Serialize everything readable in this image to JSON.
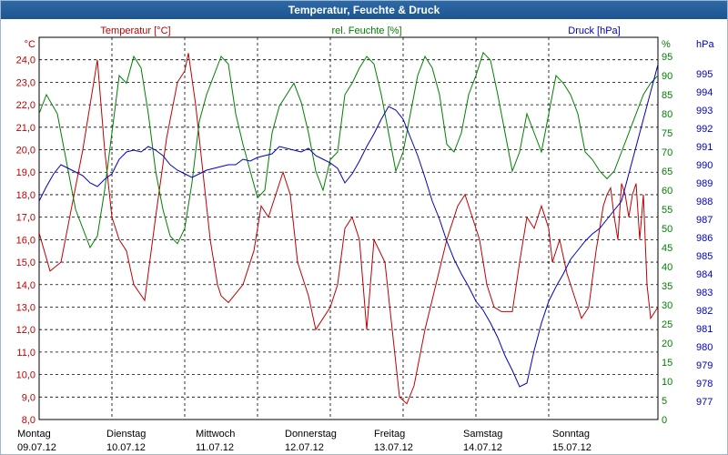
{
  "window": {
    "title": "Temperatur, Feuchte & Druck"
  },
  "chart_data": {
    "type": "line",
    "title": "Temperatur, Feuchte & Druck",
    "grid": true,
    "axes": {
      "temperature": {
        "label": "Temperatur [°C]",
        "unit": "°C",
        "color": "#c00000",
        "range": [
          8.0,
          25.0
        ],
        "ticks": [
          "8,0",
          "9,0",
          "10,0",
          "11,0",
          "12,0",
          "13,0",
          "14,0",
          "15,0",
          "16,0",
          "17,0",
          "18,0",
          "19,0",
          "20,0",
          "21,0",
          "22,0",
          "23,0",
          "24,0"
        ]
      },
      "humidity": {
        "label": "rel. Feuchte [%]",
        "unit": "%",
        "color": "#008000",
        "range": [
          0,
          100
        ],
        "ticks": [
          "0",
          "5",
          "10",
          "15",
          "20",
          "25",
          "30",
          "35",
          "40",
          "45",
          "50",
          "55",
          "60",
          "65",
          "70",
          "75",
          "80",
          "85",
          "90",
          "95"
        ]
      },
      "pressure": {
        "label": "Druck [hPa]",
        "unit": "hPa",
        "color": "#0000c0",
        "range": [
          976,
          997
        ],
        "ticks": [
          "977",
          "978",
          "979",
          "980",
          "981",
          "982",
          "983",
          "984",
          "985",
          "986",
          "987",
          "988",
          "989",
          "990",
          "991",
          "992",
          "993",
          "994",
          "995"
        ]
      }
    },
    "x_days": [
      {
        "day": "Montag",
        "date": "09.07.12"
      },
      {
        "day": "Dienstag",
        "date": "10.07.12"
      },
      {
        "day": "Mittwoch",
        "date": "11.07.12"
      },
      {
        "day": "Donnerstag",
        "date": "12.07.12"
      },
      {
        "day": "Freitag",
        "date": "13.07.12"
      },
      {
        "day": "Samstag",
        "date": "14.07.12"
      },
      {
        "day": "Sonntag",
        "date": "15.07.12"
      }
    ],
    "x_range_days": [
      0,
      7
    ],
    "series": [
      {
        "name": "Temperatur [°C]",
        "axis": "temperature",
        "color": "#c00000",
        "points": [
          [
            0.0,
            16.3
          ],
          [
            0.15,
            14.6
          ],
          [
            0.3,
            15.0
          ],
          [
            0.45,
            17.5
          ],
          [
            0.6,
            20.0
          ],
          [
            0.75,
            23.0
          ],
          [
            0.8,
            24.0
          ],
          [
            0.9,
            20.0
          ],
          [
            1.0,
            17.0
          ],
          [
            1.1,
            16.0
          ],
          [
            1.2,
            15.5
          ],
          [
            1.3,
            14.0
          ],
          [
            1.45,
            13.3
          ],
          [
            1.6,
            17.0
          ],
          [
            1.75,
            20.5
          ],
          [
            1.9,
            23.0
          ],
          [
            2.0,
            23.5
          ],
          [
            2.05,
            24.3
          ],
          [
            2.15,
            22.0
          ],
          [
            2.25,
            19.0
          ],
          [
            2.35,
            16.0
          ],
          [
            2.45,
            14.0
          ],
          [
            2.5,
            13.5
          ],
          [
            2.6,
            13.2
          ],
          [
            2.8,
            14.0
          ],
          [
            2.95,
            15.5
          ],
          [
            3.05,
            17.5
          ],
          [
            3.15,
            17.0
          ],
          [
            3.25,
            18.0
          ],
          [
            3.35,
            19.0
          ],
          [
            3.45,
            18.0
          ],
          [
            3.55,
            15.0
          ],
          [
            3.7,
            13.5
          ],
          [
            3.8,
            12.0
          ],
          [
            3.9,
            12.5
          ],
          [
            4.0,
            13.0
          ],
          [
            4.1,
            14.0
          ],
          [
            4.2,
            16.5
          ],
          [
            4.3,
            17.0
          ],
          [
            4.4,
            16.0
          ],
          [
            4.5,
            12.0
          ],
          [
            4.6,
            16.0
          ],
          [
            4.75,
            15.0
          ],
          [
            4.85,
            12.0
          ],
          [
            4.95,
            9.0
          ],
          [
            5.05,
            8.7
          ],
          [
            5.15,
            9.5
          ],
          [
            5.3,
            12.0
          ],
          [
            5.45,
            14.0
          ],
          [
            5.6,
            16.0
          ],
          [
            5.75,
            17.5
          ],
          [
            5.85,
            18.0
          ],
          [
            5.95,
            17.0
          ],
          [
            6.05,
            16.0
          ],
          [
            6.15,
            14.0
          ],
          [
            6.25,
            13.0
          ],
          [
            6.35,
            12.8
          ],
          [
            6.5,
            12.8
          ],
          [
            6.6,
            15.0
          ],
          [
            6.7,
            17.0
          ],
          [
            6.8,
            16.5
          ],
          [
            6.9,
            17.5
          ],
          [
            7.0,
            16.5
          ],
          [
            7.05,
            15.0
          ],
          [
            7.15,
            16.0
          ],
          [
            7.25,
            14.5
          ],
          [
            7.35,
            13.5
          ],
          [
            7.45,
            12.5
          ],
          [
            7.55,
            13.0
          ],
          [
            7.65,
            15.5
          ],
          [
            7.75,
            17.5
          ],
          [
            7.8,
            18.0
          ],
          [
            7.85,
            18.3
          ],
          [
            7.9,
            17.0
          ],
          [
            7.95,
            16.0
          ],
          [
            8.0,
            18.5
          ],
          [
            8.05,
            18.0
          ],
          [
            8.1,
            17.0
          ],
          [
            8.15,
            18.0
          ],
          [
            8.2,
            18.5
          ],
          [
            8.25,
            16.0
          ],
          [
            8.3,
            18.0
          ],
          [
            8.35,
            14.0
          ],
          [
            8.4,
            12.5
          ],
          [
            8.5,
            13.0
          ]
        ]
      },
      {
        "name": "rel. Feuchte [%]",
        "axis": "humidity",
        "color": "#008000",
        "points": [
          [
            0.0,
            80
          ],
          [
            0.1,
            85
          ],
          [
            0.25,
            80
          ],
          [
            0.35,
            70
          ],
          [
            0.5,
            55
          ],
          [
            0.6,
            50
          ],
          [
            0.7,
            45
          ],
          [
            0.8,
            48
          ],
          [
            0.9,
            60
          ],
          [
            1.0,
            75
          ],
          [
            1.1,
            90
          ],
          [
            1.2,
            88
          ],
          [
            1.3,
            95
          ],
          [
            1.4,
            92
          ],
          [
            1.5,
            80
          ],
          [
            1.6,
            65
          ],
          [
            1.7,
            55
          ],
          [
            1.8,
            48
          ],
          [
            1.9,
            46
          ],
          [
            2.0,
            50
          ],
          [
            2.1,
            62
          ],
          [
            2.2,
            78
          ],
          [
            2.3,
            85
          ],
          [
            2.4,
            90
          ],
          [
            2.5,
            95
          ],
          [
            2.6,
            93
          ],
          [
            2.7,
            80
          ],
          [
            2.8,
            72
          ],
          [
            2.9,
            65
          ],
          [
            3.0,
            58
          ],
          [
            3.1,
            60
          ],
          [
            3.2,
            75
          ],
          [
            3.3,
            82
          ],
          [
            3.4,
            85
          ],
          [
            3.5,
            88
          ],
          [
            3.6,
            83
          ],
          [
            3.7,
            75
          ],
          [
            3.8,
            65
          ],
          [
            3.9,
            60
          ],
          [
            4.0,
            68
          ],
          [
            4.1,
            70
          ],
          [
            4.2,
            85
          ],
          [
            4.3,
            88
          ],
          [
            4.4,
            92
          ],
          [
            4.5,
            95
          ],
          [
            4.6,
            93
          ],
          [
            4.7,
            85
          ],
          [
            4.8,
            75
          ],
          [
            4.9,
            65
          ],
          [
            5.0,
            70
          ],
          [
            5.1,
            80
          ],
          [
            5.2,
            90
          ],
          [
            5.3,
            95
          ],
          [
            5.4,
            92
          ],
          [
            5.5,
            85
          ],
          [
            5.6,
            72
          ],
          [
            5.7,
            70
          ],
          [
            5.8,
            75
          ],
          [
            5.9,
            85
          ],
          [
            6.0,
            90
          ],
          [
            6.1,
            96
          ],
          [
            6.2,
            94
          ],
          [
            6.3,
            85
          ],
          [
            6.4,
            75
          ],
          [
            6.5,
            65
          ],
          [
            6.6,
            70
          ],
          [
            6.7,
            80
          ],
          [
            6.8,
            75
          ],
          [
            6.9,
            70
          ],
          [
            7.0,
            80
          ],
          [
            7.1,
            90
          ],
          [
            7.2,
            88
          ],
          [
            7.3,
            85
          ],
          [
            7.4,
            80
          ],
          [
            7.5,
            70
          ],
          [
            7.6,
            68
          ],
          [
            7.7,
            65
          ],
          [
            7.8,
            63
          ],
          [
            7.9,
            65
          ],
          [
            8.0,
            70
          ],
          [
            8.1,
            75
          ],
          [
            8.2,
            80
          ],
          [
            8.3,
            85
          ],
          [
            8.4,
            88
          ],
          [
            8.5,
            90
          ]
        ]
      },
      {
        "name": "Druck [hPa]",
        "axis": "pressure",
        "color": "#0000c0",
        "points": [
          [
            0.0,
            988.0
          ],
          [
            0.1,
            988.8
          ],
          [
            0.2,
            989.5
          ],
          [
            0.3,
            990.0
          ],
          [
            0.4,
            989.8
          ],
          [
            0.5,
            989.6
          ],
          [
            0.6,
            989.4
          ],
          [
            0.7,
            989.0
          ],
          [
            0.8,
            988.8
          ],
          [
            0.9,
            989.2
          ],
          [
            1.0,
            989.5
          ],
          [
            1.1,
            990.3
          ],
          [
            1.2,
            990.7
          ],
          [
            1.3,
            990.8
          ],
          [
            1.4,
            990.7
          ],
          [
            1.5,
            991.0
          ],
          [
            1.6,
            990.8
          ],
          [
            1.7,
            990.5
          ],
          [
            1.8,
            990.0
          ],
          [
            1.9,
            989.7
          ],
          [
            2.0,
            989.5
          ],
          [
            2.1,
            989.3
          ],
          [
            2.2,
            989.5
          ],
          [
            2.3,
            989.7
          ],
          [
            2.4,
            989.8
          ],
          [
            2.5,
            989.9
          ],
          [
            2.6,
            990.0
          ],
          [
            2.7,
            990.0
          ],
          [
            2.8,
            990.3
          ],
          [
            2.9,
            990.2
          ],
          [
            3.0,
            990.4
          ],
          [
            3.1,
            990.5
          ],
          [
            3.2,
            990.6
          ],
          [
            3.3,
            991.0
          ],
          [
            3.4,
            990.9
          ],
          [
            3.5,
            990.8
          ],
          [
            3.6,
            990.7
          ],
          [
            3.7,
            990.9
          ],
          [
            3.8,
            990.5
          ],
          [
            3.9,
            990.3
          ],
          [
            4.0,
            990.1
          ],
          [
            4.1,
            989.8
          ],
          [
            4.2,
            989.0
          ],
          [
            4.3,
            989.5
          ],
          [
            4.4,
            990.2
          ],
          [
            4.5,
            991.0
          ],
          [
            4.6,
            991.7
          ],
          [
            4.7,
            992.5
          ],
          [
            4.8,
            993.2
          ],
          [
            4.9,
            993.0
          ],
          [
            5.0,
            992.5
          ],
          [
            5.1,
            991.5
          ],
          [
            5.2,
            990.5
          ],
          [
            5.3,
            989.3
          ],
          [
            5.4,
            988.0
          ],
          [
            5.5,
            987.0
          ],
          [
            5.6,
            985.8
          ],
          [
            5.7,
            984.8
          ],
          [
            5.8,
            984.0
          ],
          [
            5.9,
            983.3
          ],
          [
            6.0,
            982.5
          ],
          [
            6.1,
            982.0
          ],
          [
            6.2,
            981.3
          ],
          [
            6.3,
            980.5
          ],
          [
            6.4,
            979.5
          ],
          [
            6.5,
            978.7
          ],
          [
            6.6,
            977.8
          ],
          [
            6.7,
            978.0
          ],
          [
            6.8,
            979.8
          ],
          [
            6.9,
            981.3
          ],
          [
            7.0,
            982.5
          ],
          [
            7.1,
            983.3
          ],
          [
            7.2,
            984.0
          ],
          [
            7.3,
            984.8
          ],
          [
            7.4,
            985.3
          ],
          [
            7.5,
            985.8
          ],
          [
            7.6,
            986.2
          ],
          [
            7.7,
            986.5
          ],
          [
            7.8,
            987.0
          ],
          [
            7.9,
            987.5
          ],
          [
            8.0,
            988.0
          ],
          [
            8.1,
            989.5
          ],
          [
            8.2,
            991.0
          ],
          [
            8.3,
            992.5
          ],
          [
            8.4,
            994.0
          ],
          [
            8.5,
            995.5
          ]
        ]
      }
    ]
  }
}
